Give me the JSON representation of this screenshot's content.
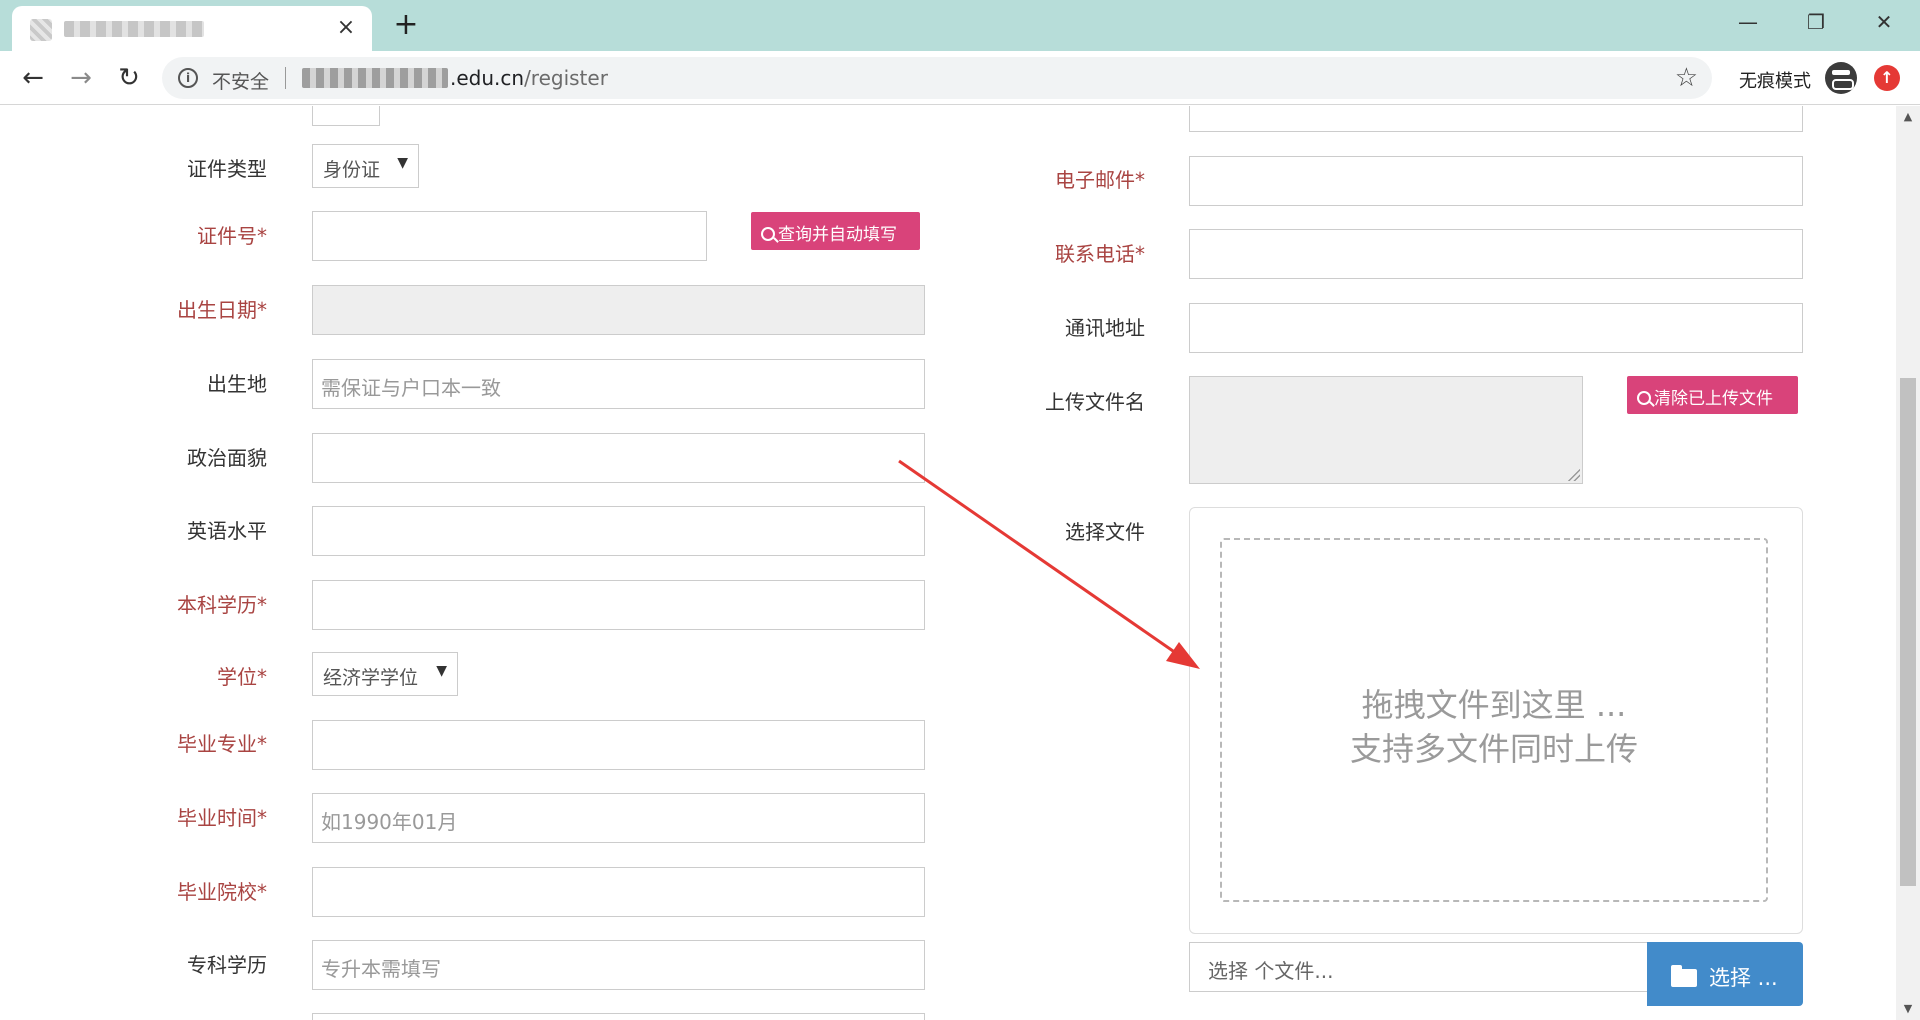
{
  "browser": {
    "tab_title": "",
    "new_tab": "+",
    "close_tab": "×",
    "insecure_label": "不安全",
    "url_domain": ".edu.cn",
    "url_path": "/register",
    "incognito_label": "无痕模式",
    "win_min": "—",
    "win_max": "❐",
    "win_close": "✕",
    "back": "←",
    "forward": "→",
    "reload": "↻",
    "star": "☆",
    "info": "i",
    "update": "↑"
  },
  "left_form": {
    "id_type_label": "证件类型",
    "id_type_value": "身份证",
    "id_number_label": "证件号*",
    "lookup_button": "查询并自动填写",
    "birth_date_label": "出生日期*",
    "birthplace_label": "出生地",
    "birthplace_placeholder": "需保证与户口本一致",
    "political_label": "政治面貌",
    "english_label": "英语水平",
    "bachelor_label": "本科学历*",
    "degree_label": "学位*",
    "degree_value": "经济学学位",
    "major_label": "毕业专业*",
    "grad_time_label": "毕业时间*",
    "grad_time_placeholder": "如1990年01月",
    "school_label": "毕业院校*",
    "college_label": "专科学历",
    "college_placeholder": "专升本需填写"
  },
  "right_form": {
    "email_label": "电子邮件*",
    "phone_label": "联系电话*",
    "address_label": "通讯地址",
    "upload_name_label": "上传文件名",
    "clear_button": "清除已上传文件",
    "choose_file_label": "选择文件",
    "drop_line1": "拖拽文件到这里 ...",
    "drop_line2": "支持多文件同时上传",
    "file_caption": "选择 个文件...",
    "browse_button": "选择 ..."
  },
  "scrollbar": {
    "up": "▲",
    "down": "▼",
    "position": 0.3
  },
  "colors": {
    "required": "#a94442",
    "pink_button": "#d9437a",
    "blue_button": "#428bca",
    "tabbar": "#b7ddd9",
    "annotation_arrow": "#e53935"
  }
}
